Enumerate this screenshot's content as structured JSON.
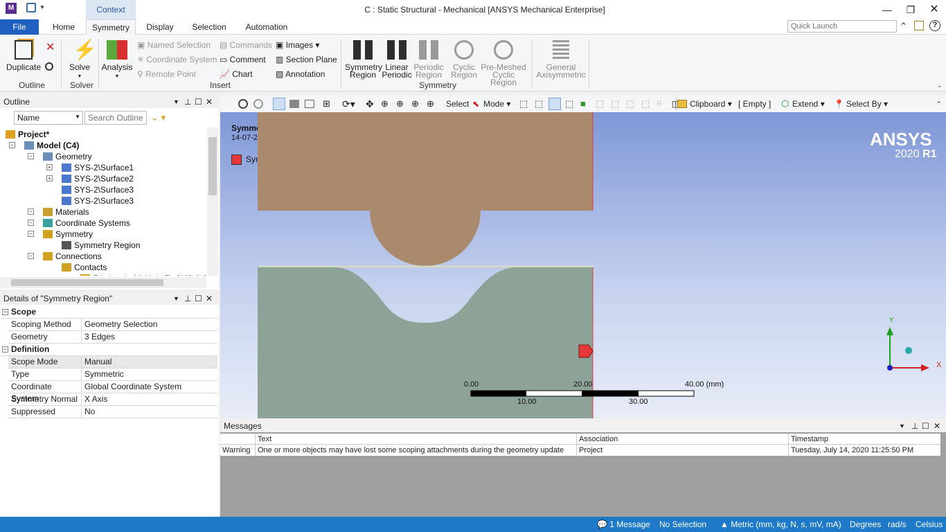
{
  "app": {
    "logo": "M",
    "context_tab": "Context",
    "window_title": "C : Static Structural - Mechanical [ANSYS Mechanical Enterprise]",
    "window_controls": [
      "minimize-icon",
      "restore-icon",
      "close-icon"
    ]
  },
  "tabs": [
    "File",
    "Home",
    "Symmetry",
    "Display",
    "Selection",
    "Automation"
  ],
  "active_tab": "Symmetry",
  "quick_launch_placeholder": "Quick Launch",
  "ribbon": {
    "outline": {
      "duplicate": "Duplicate",
      "group": "Outline"
    },
    "solver": {
      "solve": "Solve",
      "group": "Solver"
    },
    "insert": {
      "analysis": "Analysis",
      "named_selection": "Named Selection",
      "coordinate_system": "Coordinate System",
      "remote_point": "Remote Point",
      "commands": "Commands",
      "comment": "Comment",
      "chart": "Chart",
      "images": "Images",
      "section_plane": "Section Plane",
      "annotation": "Annotation",
      "group": "Insert"
    },
    "symmetry": {
      "symmetry_region_1": "Symmetry",
      "symmetry_region_2": "Region",
      "linear_periodic_1": "Linear",
      "linear_periodic_2": "Periodic",
      "periodic_region_1": "Periodic",
      "periodic_region_2": "Region",
      "cyclic_region_1": "Cyclic",
      "cyclic_region_2": "Region",
      "pre_meshed_1": "Pre-Meshed",
      "pre_meshed_2": "Cyclic Region",
      "general_axi_1": "General",
      "general_axi_2": "Axisymmetric",
      "group": "Symmetry"
    }
  },
  "toolbar": {
    "select": "Select",
    "mode": "Mode",
    "clipboard": "Clipboard",
    "empty": "[ Empty ]",
    "extend": "Extend",
    "select_by": "Select By"
  },
  "outline": {
    "title": "Outline",
    "filter": "Name",
    "search_placeholder": "Search Outline",
    "tree": [
      {
        "label": "Project*",
        "level": 0,
        "bold": true
      },
      {
        "label": "Model (C4)",
        "level": 1,
        "bold": true
      },
      {
        "label": "Geometry",
        "level": 2
      },
      {
        "label": "SYS-2\\Surface1",
        "level": 3
      },
      {
        "label": "SYS-2\\Surface2",
        "level": 3
      },
      {
        "label": "SYS-2\\Surface3",
        "level": 3
      },
      {
        "label": "SYS-2\\Surface3",
        "level": 3
      },
      {
        "label": "Materials",
        "level": 2
      },
      {
        "label": "Coordinate Systems",
        "level": 2
      },
      {
        "label": "Symmetry",
        "level": 2
      },
      {
        "label": "Symmetry Region",
        "level": 3,
        "selected": true
      },
      {
        "label": "Connections",
        "level": 2
      },
      {
        "label": "Contacts",
        "level": 3
      },
      {
        "label": "Frictional - Multiple To SYS-2\\Surf",
        "level": 4
      }
    ]
  },
  "details": {
    "title": "Details of \"Symmetry Region\"",
    "scope_header": "Scope",
    "scope_rows": [
      {
        "key": "Scoping Method",
        "value": "Geometry Selection"
      },
      {
        "key": "Geometry",
        "value": "3 Edges"
      }
    ],
    "definition_header": "Definition",
    "definition_rows": [
      {
        "key": "Scope Mode",
        "value": "Manual"
      },
      {
        "key": "Type",
        "value": "Symmetric"
      },
      {
        "key": "Coordinate System",
        "value": "Global Coordinate System"
      },
      {
        "key": "Symmetry Normal",
        "value": "X Axis"
      },
      {
        "key": "Suppressed",
        "value": "No"
      }
    ]
  },
  "viewport": {
    "title": "Symmetry Region",
    "date": "14-07-2020 23:29",
    "legend": "Symmetry Region",
    "brand": "ANSYS",
    "version": "2020",
    "release": "R1",
    "scale_labels_top": [
      "0.00",
      "20.00",
      "40.00 (mm)"
    ],
    "scale_labels_bottom": [
      "10.00",
      "30.00"
    ],
    "axis_y": "Y",
    "axis_x": "X",
    "colors": {
      "top_part": "#a98a6c",
      "bottom_part": "#8ea398",
      "symmetry": "#e63838"
    }
  },
  "messages": {
    "title": "Messages",
    "columns": [
      "Text",
      "Association",
      "Timestamp"
    ],
    "rows": [
      {
        "type": "Warning",
        "text": "One or more objects may have lost some scoping attachments during the geometry update",
        "association": "Project",
        "timestamp": "Tuesday, July 14, 2020 11:25:50 PM"
      }
    ]
  },
  "status": {
    "messages": "1 Message",
    "selection": "No Selection",
    "units": "Metric (mm, kg, N, s, mV, mA)",
    "angle": "Degrees",
    "rot": "rad/s",
    "temp": "Celsius"
  }
}
